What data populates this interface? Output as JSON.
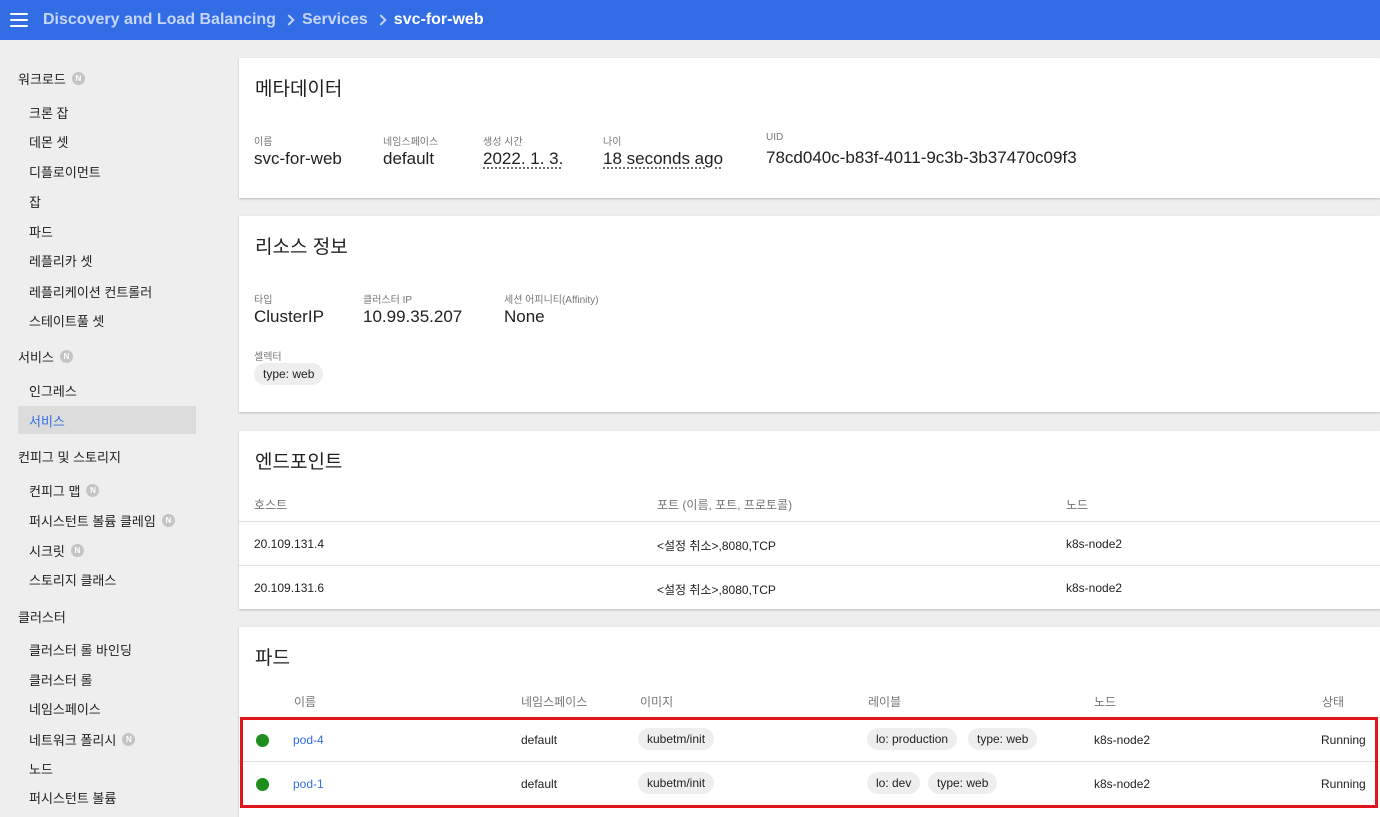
{
  "breadcrumb": {
    "section": "Discovery and Load Balancing",
    "parent": "Services",
    "current": "svc-for-web"
  },
  "sidebar": {
    "namespace_badge": "N",
    "workloads": {
      "label": "워크로드",
      "items": [
        "크론 잡",
        "데몬 셋",
        "디플로이먼트",
        "잡",
        "파드",
        "레플리카 셋",
        "레플리케이션 컨트롤러",
        "스테이트풀 셋"
      ]
    },
    "services": {
      "label": "서비스",
      "items": [
        "인그레스",
        "서비스"
      ]
    },
    "config": {
      "label": "컨피그 및 스토리지",
      "items": [
        "컨피그 맵",
        "퍼시스턴트 볼륨 클레임",
        "시크릿",
        "스토리지 클래스"
      ]
    },
    "cluster": {
      "label": "클러스터",
      "items": [
        "클러스터 롤 바인딩",
        "클러스터 롤",
        "네임스페이스",
        "네트워크 폴리시",
        "노드",
        "퍼시스턴트 볼륨"
      ]
    }
  },
  "metadata": {
    "title": "메타데이터",
    "name_label": "이름",
    "name": "svc-for-web",
    "namespace_label": "네임스페이스",
    "namespace": "default",
    "created_label": "생성 시간",
    "created": "2022. 1. 3.",
    "age_label": "나이",
    "age": "18 seconds ago",
    "uid_label": "UID",
    "uid": "78cd040c-b83f-4011-9c3b-3b37470c09f3"
  },
  "resource": {
    "title": "리소스 정보",
    "type_label": "타입",
    "type": "ClusterIP",
    "cluster_ip_label": "클러스터 IP",
    "cluster_ip": "10.99.35.207",
    "affinity_label": "세션 어피니티(Affinity)",
    "affinity": "None",
    "selector_label": "셀렉터",
    "selector": "type: web"
  },
  "endpoints": {
    "title": "엔드포인트",
    "headers": {
      "host": "호스트",
      "ports": "포트 (이름, 포트, 프로토콜)",
      "node": "노드"
    },
    "rows": [
      {
        "host": "20.109.131.4",
        "ports": "<설정 취소>,8080,TCP",
        "node": "k8s-node2"
      },
      {
        "host": "20.109.131.6",
        "ports": "<설정 취소>,8080,TCP",
        "node": "k8s-node2"
      }
    ]
  },
  "pods": {
    "title": "파드",
    "headers": {
      "name": "이름",
      "namespace": "네임스페이스",
      "image": "이미지",
      "labels": "레이블",
      "node": "노드",
      "status": "상태"
    },
    "rows": [
      {
        "name": "pod-4",
        "namespace": "default",
        "image": "kubetm/init",
        "label1": "lo: production",
        "label2": "type: web",
        "node": "k8s-node2",
        "status": "Running"
      },
      {
        "name": "pod-1",
        "namespace": "default",
        "image": "kubetm/init",
        "label1": "lo: dev",
        "label2": "type: web",
        "node": "k8s-node2",
        "status": "Running"
      }
    ]
  },
  "colors": {
    "primary": "#326de6",
    "running": "#1e8e1e",
    "highlight": "#e0161e"
  }
}
